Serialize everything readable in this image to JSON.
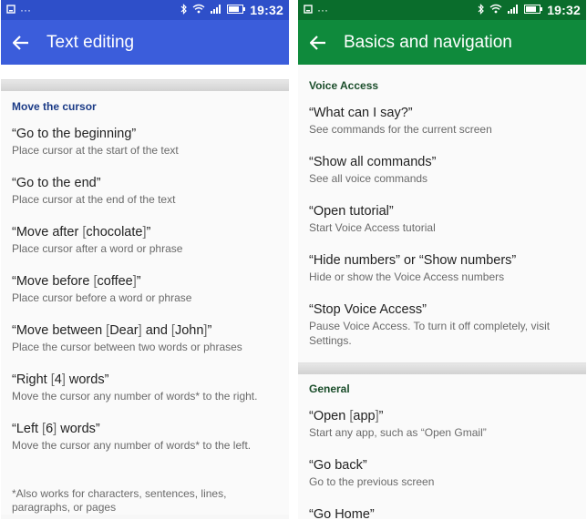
{
  "left_screen": {
    "status": {
      "time": "19:32",
      "notif": "···"
    },
    "title": "Text editing",
    "section_title": "Move the cursor",
    "items": [
      {
        "t1": "“Go to the beginning”",
        "sub": "Place cursor at the start of the text"
      },
      {
        "t1": "“Go to the end”",
        "sub": "Place cursor at the end of the text"
      },
      {
        "a": "“Move after ",
        "b": "[",
        "c": "chocolate",
        "d": "]",
        "e": "”",
        "sub": "Place cursor after a word or phrase"
      },
      {
        "a": "“Move before ",
        "b": "[",
        "c": "coffee",
        "d": "]",
        "e": "”",
        "sub": "Place cursor before a word or phrase"
      },
      {
        "a": "“Move between ",
        "b": "[",
        "c": "Dear",
        "d": "]",
        "e": " and ",
        "f": "[",
        "g": "John",
        "h": "]",
        "i": "”",
        "sub": "Place the cursor between two words or phrases"
      },
      {
        "a": "“Right ",
        "b": "[",
        "c": "4",
        "d": "]",
        "e": " words”",
        "sub": "Move the cursor any number of words* to the right."
      },
      {
        "a": "“Left ",
        "b": "[",
        "c": "6",
        "d": "]",
        "e": " words”",
        "sub": "Move the cursor any number of words* to the left."
      }
    ],
    "footnote": "*Also works for characters, sentences, lines, paragraphs, or pages"
  },
  "right_screen": {
    "status": {
      "time": "19:32",
      "notif": "···"
    },
    "title": "Basics and navigation",
    "section1_title": "Voice Access",
    "items": [
      {
        "t1": "“What can I say?”",
        "sub": "See commands for the current screen"
      },
      {
        "t1": "“Show all commands”",
        "sub": "See all voice commands"
      },
      {
        "t1": "“Open tutorial”",
        "sub": "Start Voice Access tutorial"
      },
      {
        "t1": "“Hide numbers” or “Show numbers”",
        "sub": "Hide or show the Voice Access numbers"
      },
      {
        "t1": "“Stop Voice Access”",
        "sub": "Pause Voice Access. To turn it off completely, visit Settings."
      }
    ],
    "section2_title": "General",
    "items2": [
      {
        "a": "“Open ",
        "b": "[",
        "c": "app",
        "d": "]",
        "e": "”",
        "sub": "Start any app, such as “Open Gmail”"
      },
      {
        "t1": "“Go back”",
        "sub": "Go to the previous screen"
      },
      {
        "t1": "“Go Home”"
      }
    ]
  },
  "colors": {
    "left_appbar": "#3b5ddb",
    "left_statusbar": "#2e4fc9",
    "right_appbar": "#0f8a3c",
    "right_statusbar": "#0a6d2c"
  }
}
